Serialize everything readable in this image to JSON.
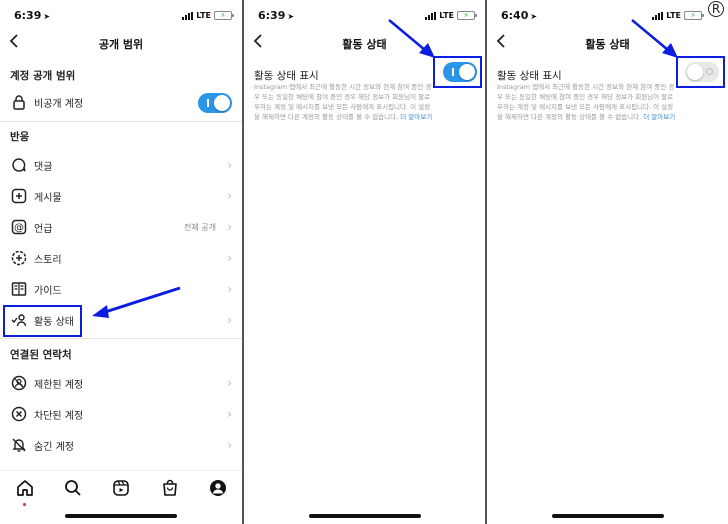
{
  "colors": {
    "toggle_on": "#2b95e8",
    "highlight": "#0b1ee0",
    "link": "#3c86d6"
  },
  "panel1": {
    "status": {
      "time": "6:39",
      "network": "LTE"
    },
    "title": "공개 범위",
    "section_account": "계정 공개 범위",
    "private_account": {
      "label": "비공개 계정",
      "toggle": "on"
    },
    "section_interactions": "반응",
    "items": [
      {
        "label": "댓글",
        "icon": "comment-icon"
      },
      {
        "label": "게시물",
        "icon": "plus-square-icon"
      },
      {
        "label": "언급",
        "icon": "at-icon",
        "value": "전체 공개"
      },
      {
        "label": "스토리",
        "icon": "story-plus-icon"
      },
      {
        "label": "가이드",
        "icon": "guide-icon"
      },
      {
        "label": "활동 상태",
        "icon": "activity-status-icon"
      }
    ],
    "section_connections": "연결된 연락처",
    "connections": [
      {
        "label": "제한된 계정",
        "icon": "restricted-icon"
      },
      {
        "label": "차단된 계정",
        "icon": "blocked-icon"
      },
      {
        "label": "숨긴 계정",
        "icon": "muted-bell-icon"
      }
    ]
  },
  "panel2": {
    "status": {
      "time": "6:39",
      "network": "LTE"
    },
    "title": "활동 상태",
    "setting_label": "활동 상태 표시",
    "toggle": "on",
    "description": "Instagram 앱에서 최근에 활동한 시간 정보와 현재 참여 중인 경우 또는 동일한 채팅에 참여 중인 경우 해당 정보가 회원님이 팔로우하는 계정 및 메시지를 보낸 모든 사람에게 표시됩니다. 이 설정을 해제하면 다른 계정의 활동 상태를 볼 수 없습니다.",
    "learn_more": "더 알아보기"
  },
  "panel3": {
    "status": {
      "time": "6:40",
      "network": "LTE"
    },
    "title": "활동 상태",
    "setting_label": "활동 상태 표시",
    "toggle": "off",
    "description": "Instagram 앱에서 최근에 활동한 시간 정보와 현재 참여 중인 경우 또는 동일한 채팅에 참여 중인 경우 해당 정보가 회원님이 팔로우하는 계정 및 메시지를 보낸 모든 사람에게 표시됩니다. 이 설정을 해제하면 다른 계정의 활동 상태를 볼 수 없습니다.",
    "learn_more": "더 알아보기",
    "corner_mark": "R"
  }
}
